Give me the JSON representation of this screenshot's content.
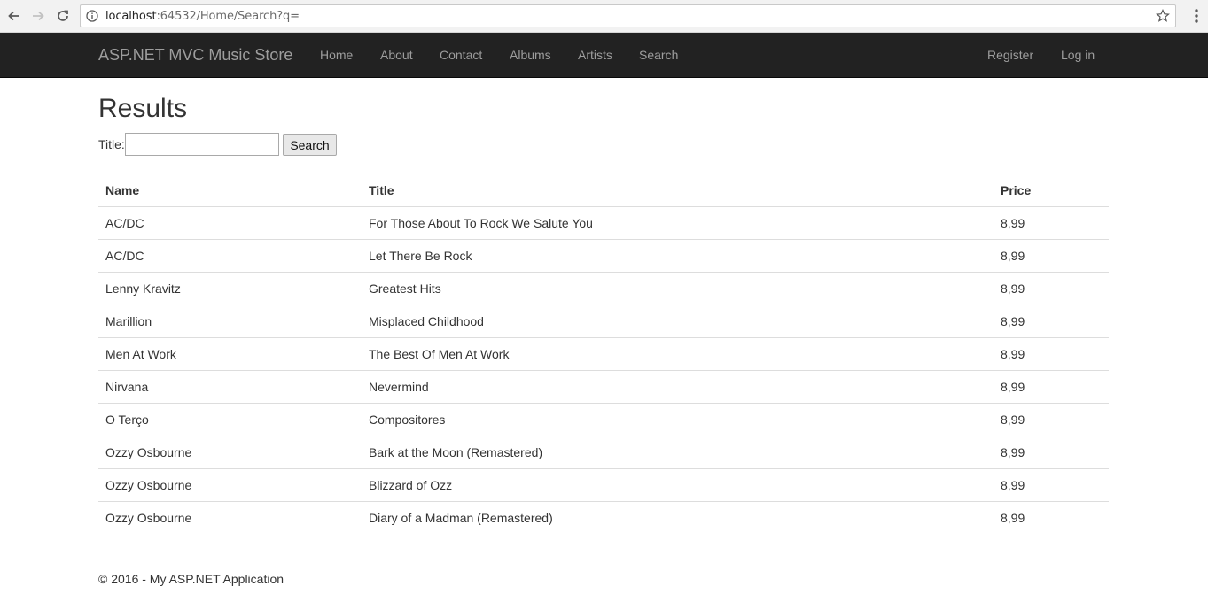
{
  "browser": {
    "url_host": "localhost",
    "url_rest": ":64532/Home/Search?q="
  },
  "navbar": {
    "brand": "ASP.NET MVC Music Store",
    "links": [
      "Home",
      "About",
      "Contact",
      "Albums",
      "Artists",
      "Search"
    ],
    "right_links": [
      "Register",
      "Log in"
    ]
  },
  "page": {
    "title": "Results",
    "search_label": "Title:",
    "search_value": "",
    "search_button": "Search"
  },
  "table": {
    "columns": [
      "Name",
      "Title",
      "Price"
    ],
    "rows": [
      [
        "AC/DC",
        "For Those About To Rock We Salute You",
        "8,99"
      ],
      [
        "AC/DC",
        "Let There Be Rock",
        "8,99"
      ],
      [
        "Lenny Kravitz",
        "Greatest Hits",
        "8,99"
      ],
      [
        "Marillion",
        "Misplaced Childhood",
        "8,99"
      ],
      [
        "Men At Work",
        "The Best Of Men At Work",
        "8,99"
      ],
      [
        "Nirvana",
        "Nevermind",
        "8,99"
      ],
      [
        "O Terço",
        "Compositores",
        "8,99"
      ],
      [
        "Ozzy Osbourne",
        "Bark at the Moon (Remastered)",
        "8,99"
      ],
      [
        "Ozzy Osbourne",
        "Blizzard of Ozz",
        "8,99"
      ],
      [
        "Ozzy Osbourne",
        "Diary of a Madman (Remastered)",
        "8,99"
      ]
    ]
  },
  "footer": {
    "text": "© 2016 - My ASP.NET Application"
  }
}
